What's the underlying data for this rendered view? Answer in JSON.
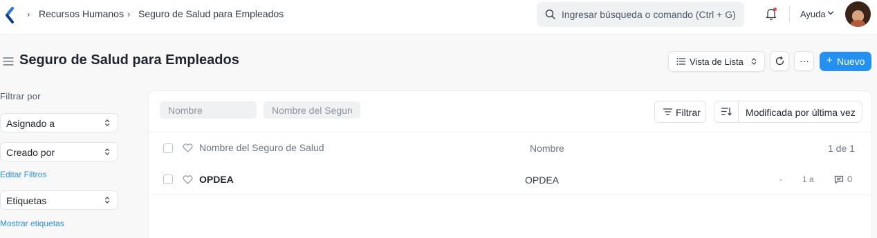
{
  "navbar": {
    "breadcrumbs": [
      "Recursos Humanos",
      "Seguro de Salud para Empleados"
    ],
    "search_placeholder": "Ingresar búsqueda o comando (Ctrl + G)",
    "help_label": "Ayuda",
    "accent": "#2490ef",
    "notification_dot": "#e24c4c"
  },
  "page": {
    "title": "Seguro de Salud para Empleados",
    "view_label": "Vista de Lista",
    "more_label": "···",
    "new_label": "Nuevo"
  },
  "sidebar": {
    "filter_heading": "Filtrar por",
    "assigned_label": "Asignado a",
    "created_label": "Creado por",
    "edit_filters": "Editar Filtros",
    "tags_label": "Etiquetas",
    "show_tags": "Mostrar etiquetas"
  },
  "list": {
    "filter_name_placeholder": "Nombre",
    "filter_insurance_placeholder": "Nombre del Seguro de Salud",
    "filter_button": "Filtrar",
    "sort_label": "Modificada por última vez",
    "columns": {
      "title": "Nombre del Seguro de Salud",
      "name": "Nombre",
      "count": "1 de 1"
    },
    "rows": [
      {
        "title": "OPDEA",
        "name": "OPDEA",
        "dash": "-",
        "age": "1 a",
        "comments": "0"
      }
    ]
  }
}
